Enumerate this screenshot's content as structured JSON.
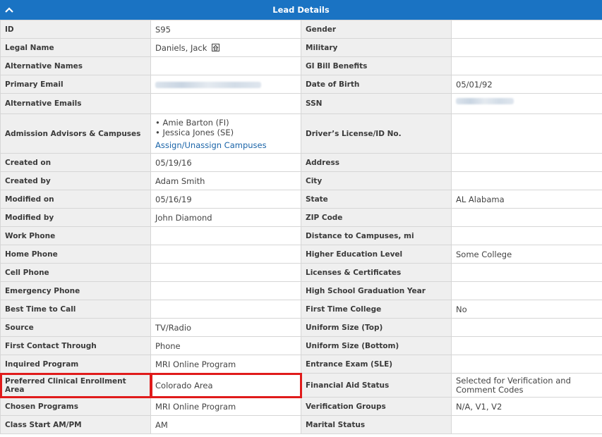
{
  "header": {
    "title": "Lead Details"
  },
  "colors": {
    "header_bg": "#1a73c3",
    "label_bg": "#efefef",
    "link": "#1a64a8",
    "highlight": "#e01b1b"
  },
  "icons": {
    "collapse": "chevron-up-icon",
    "home": "home-icon"
  },
  "rows": {
    "r1": {
      "left_label": "ID",
      "left_value": "S95",
      "right_label": "Gender",
      "right_value": ""
    },
    "r2": {
      "left_label": "Legal Name",
      "left_value": "Daniels, Jack",
      "right_label": "Military",
      "right_value": ""
    },
    "r3": {
      "left_label": "Alternative Names",
      "left_value": "",
      "right_label": "GI Bill Benefits",
      "right_value": ""
    },
    "r4": {
      "left_label": "Primary Email",
      "left_value": "",
      "right_label": "Date of Birth",
      "right_value": "05/01/92"
    },
    "r5": {
      "left_label": "Alternative Emails",
      "left_value": "",
      "right_label": "SSN",
      "right_value": ""
    },
    "r6": {
      "left_label": "Admission Advisors & Campuses",
      "advisor1": "Amie Barton (FI)",
      "advisor2": "Jessica Jones (SE)",
      "assign_link": "Assign/Unassign Campuses",
      "right_label": "Driver’s License/ID No.",
      "right_value": ""
    },
    "r7": {
      "left_label": "Created on",
      "left_value": "05/19/16",
      "right_label": "Address",
      "right_value": ""
    },
    "r8": {
      "left_label": "Created by",
      "left_value": "Adam Smith",
      "right_label": "City",
      "right_value": ""
    },
    "r9": {
      "left_label": "Modified on",
      "left_value": "05/16/19",
      "right_label": "State",
      "right_value": "AL Alabama"
    },
    "r10": {
      "left_label": "Modified by",
      "left_value": "John Diamond",
      "right_label": "ZIP Code",
      "right_value": ""
    },
    "r11": {
      "left_label": "Work Phone",
      "left_value": "",
      "right_label": "Distance to Campuses, mi",
      "right_value": ""
    },
    "r12": {
      "left_label": "Home Phone",
      "left_value": "",
      "right_label": "Higher Education Level",
      "right_value": "Some College"
    },
    "r13": {
      "left_label": "Cell Phone",
      "left_value": "",
      "right_label": "Licenses & Certificates",
      "right_value": ""
    },
    "r14": {
      "left_label": "Emergency Phone",
      "left_value": "",
      "right_label": "High School Graduation Year",
      "right_value": ""
    },
    "r15": {
      "left_label": "Best Time to Call",
      "left_value": "",
      "right_label": "First Time College",
      "right_value": "No"
    },
    "r16": {
      "left_label": "Source",
      "left_value": "TV/Radio",
      "right_label": "Uniform Size (Top)",
      "right_value": ""
    },
    "r17": {
      "left_label": "First Contact Through",
      "left_value": "Phone",
      "right_label": "Uniform Size (Bottom)",
      "right_value": ""
    },
    "r18": {
      "left_label": "Inquired Program",
      "left_value": "MRI Online Program",
      "right_label": "Entrance Exam (SLE)",
      "right_value": ""
    },
    "r19": {
      "left_label": "Preferred Clinical Enrollment Area",
      "left_value": "Colorado Area",
      "right_label": "Financial Aid Status",
      "right_value_line1": "Selected for Verification and",
      "right_value_line2": "Comment Codes"
    },
    "r20": {
      "left_label": "Chosen Programs",
      "left_value": "MRI Online Program",
      "right_label": "Verification Groups",
      "right_value": "N/A, V1, V2"
    },
    "r21": {
      "left_label": "Class Start AM/PM",
      "left_value": "AM",
      "right_label": "Marital Status",
      "right_value": ""
    }
  }
}
